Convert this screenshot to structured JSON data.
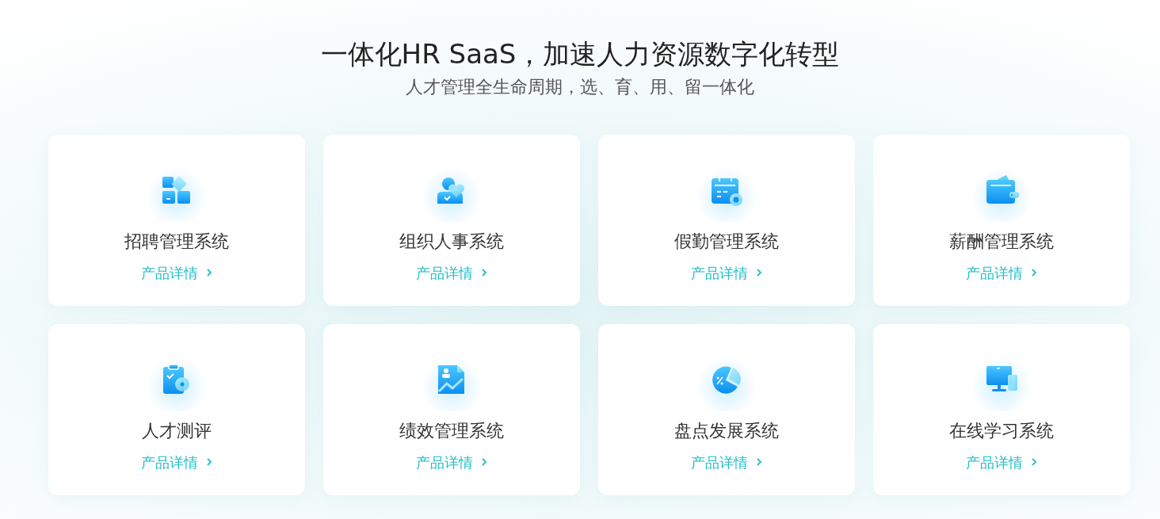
{
  "header": {
    "title": "一体化HR SaaS，加速人力资源数字化转型",
    "subtitle": "人才管理全生命周期，选、育、用、留一体化"
  },
  "products": [
    {
      "kind": "blocks",
      "name": "招聘管理系统",
      "link": "产品详情"
    },
    {
      "kind": "person",
      "name": "组织人事系统",
      "link": "产品详情"
    },
    {
      "kind": "calendar",
      "name": "假勤管理系统",
      "link": "产品详情"
    },
    {
      "kind": "wallet",
      "name": "薪酬管理系统",
      "link": "产品详情"
    },
    {
      "kind": "clipboard",
      "name": "人才测评",
      "link": "产品详情"
    },
    {
      "kind": "document",
      "name": "绩效管理系统",
      "link": "产品详情"
    },
    {
      "kind": "pie",
      "name": "盘点发展系统",
      "link": "产品详情"
    },
    {
      "kind": "monitor",
      "name": "在线学习系统",
      "link": "产品详情"
    }
  ]
}
